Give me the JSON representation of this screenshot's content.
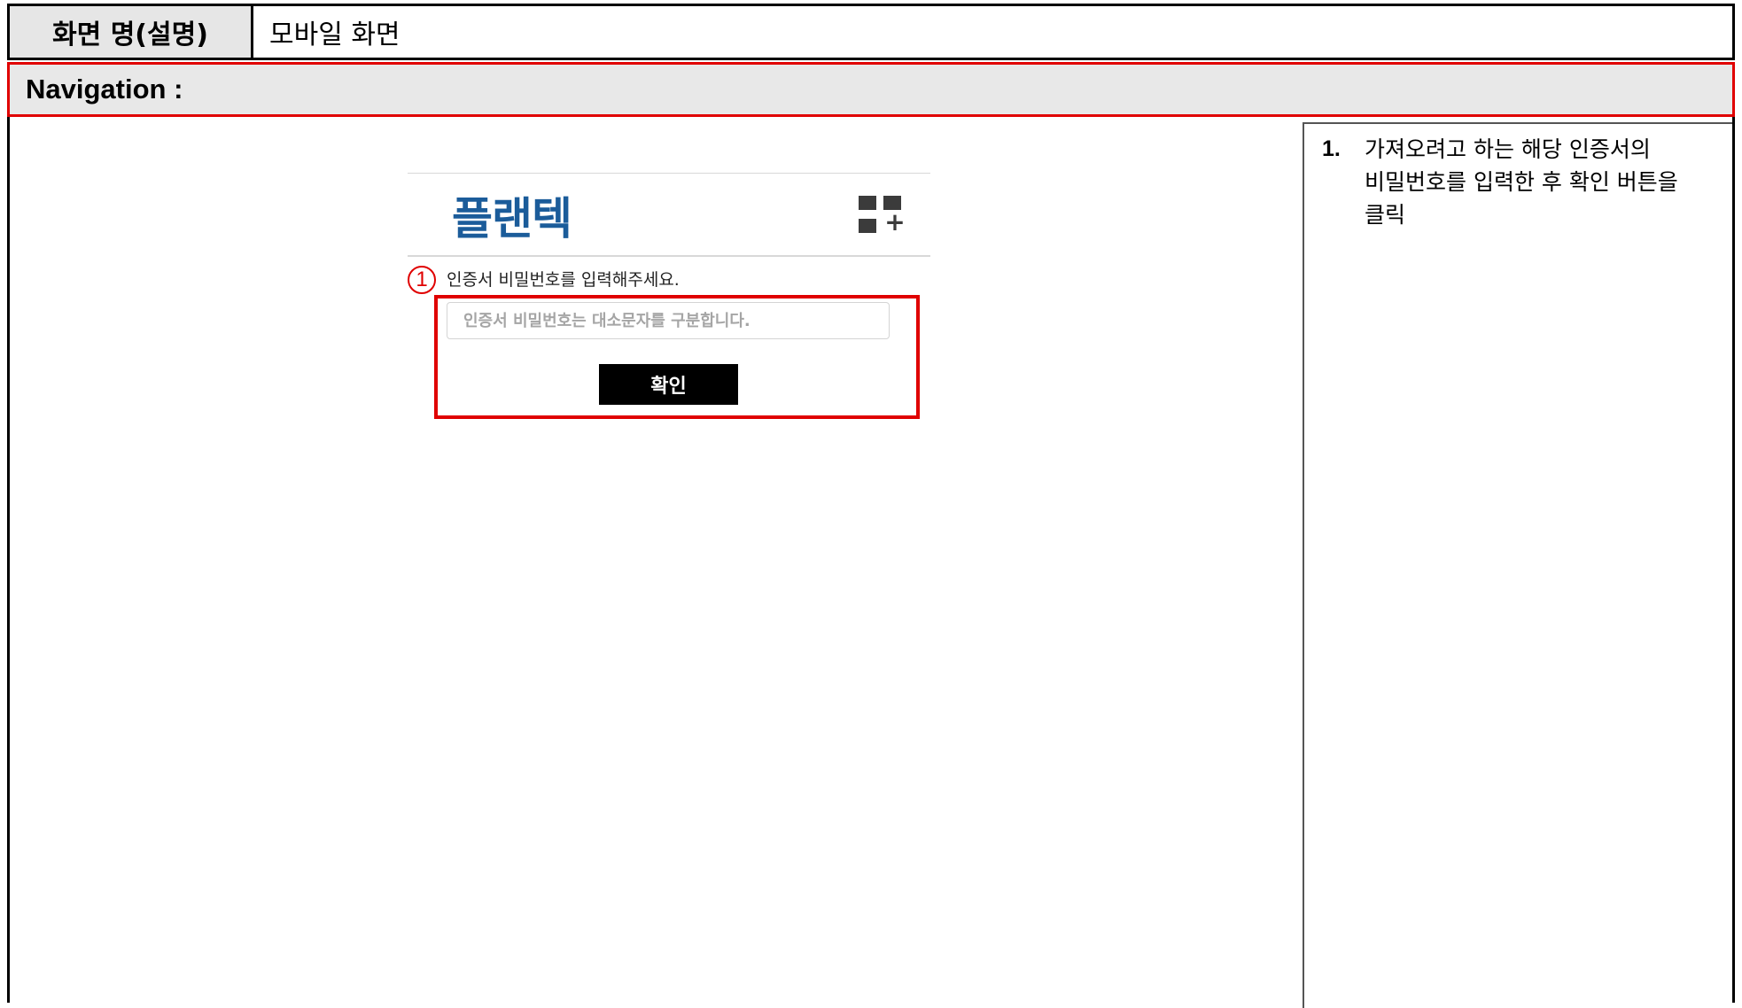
{
  "header": {
    "label": "화면 명(설명)",
    "value": "모바일 화면"
  },
  "navigation": {
    "label": "Navigation :"
  },
  "mobile": {
    "logo": "플랜텍",
    "marker": "1",
    "prompt": "인증서 비밀번호를 입력해주세요.",
    "password_placeholder": "인증서 비밀번호는 대소문자를 구분합니다.",
    "password_value": "",
    "confirm_label": "확인"
  },
  "description": {
    "items": [
      {
        "number": "1.",
        "text": "가져오려고 하는 해당 인증서의 비밀번호를 입력한 후 확인 버튼을 클릭"
      }
    ]
  },
  "colors": {
    "highlight": "#e00000",
    "logo": "#1b5c9a",
    "header_bg": "#e6e6e6"
  }
}
